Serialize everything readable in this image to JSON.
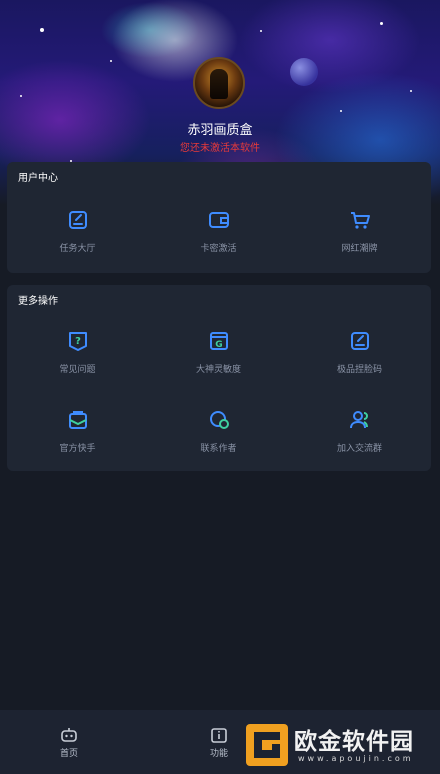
{
  "profile": {
    "app_name": "赤羽画质盒",
    "activation_status": "您还未激活本软件"
  },
  "user_center": {
    "title": "用户中心",
    "items": [
      {
        "label": "任务大厅",
        "icon": "task-edit-icon"
      },
      {
        "label": "卡密激活",
        "icon": "wallet-card-icon"
      },
      {
        "label": "网红潮牌",
        "icon": "shopping-cart-icon"
      }
    ]
  },
  "more_actions": {
    "title": "更多操作",
    "items": [
      {
        "label": "常见问题",
        "icon": "question-shield-icon"
      },
      {
        "label": "大神灵敏度",
        "icon": "g-badge-icon"
      },
      {
        "label": "极品捏脸码",
        "icon": "edit-note-icon"
      },
      {
        "label": "官方快手",
        "icon": "mail-box-icon"
      },
      {
        "label": "联系作者",
        "icon": "chat-bubble-icon"
      },
      {
        "label": "加入交流群",
        "icon": "group-users-icon"
      }
    ]
  },
  "tabbar": {
    "tabs": [
      {
        "label": "首页",
        "icon": "robot-face-icon"
      },
      {
        "label": "功能",
        "icon": "info-box-icon"
      }
    ]
  },
  "watermark": {
    "title": "欧金软件园",
    "url": "www.apoujin.com"
  },
  "colors": {
    "accent": "#3f8cff",
    "warning": "#e83a3a",
    "card": "#1f2633",
    "background": "#161b25"
  }
}
